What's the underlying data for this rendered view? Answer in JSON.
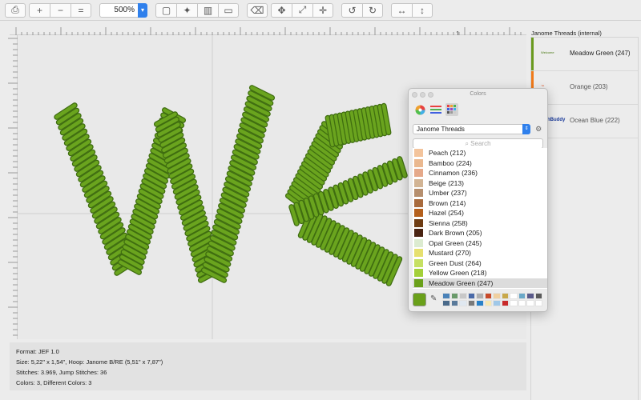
{
  "toolbar": {
    "buttons": [
      {
        "name": "print-icon",
        "glyph": "🖶"
      },
      {
        "name": "zoom-in-icon",
        "glyph": "+"
      },
      {
        "name": "zoom-out-icon",
        "glyph": "−"
      },
      {
        "name": "zoom-actual-icon",
        "glyph": "="
      },
      {
        "name": "select-rect-icon",
        "glyph": "▢"
      },
      {
        "name": "magic-wand-icon",
        "glyph": "⚚"
      },
      {
        "name": "stitch-icon",
        "glyph": "▥"
      },
      {
        "name": "ruler-icon",
        "glyph": "▭"
      },
      {
        "name": "trash-icon",
        "glyph": "🗑"
      },
      {
        "name": "move-icon",
        "glyph": "✥"
      },
      {
        "name": "resize-icon",
        "glyph": "⤢"
      },
      {
        "name": "center-icon",
        "glyph": "✛"
      },
      {
        "name": "rotate-left-icon",
        "glyph": "↺"
      },
      {
        "name": "rotate-right-icon",
        "glyph": "↻"
      },
      {
        "name": "flip-horizontal-icon",
        "glyph": "↔"
      },
      {
        "name": "flip-vertical-icon",
        "glyph": "↕"
      }
    ],
    "zoom_value": "500%"
  },
  "ruler": {
    "marker": "1"
  },
  "info": {
    "format": "Format: JEF 1.0",
    "size": "Size: 5,22\" x 1,54\", Hoop: Janome B/RE (5,51\" x 7,87\")",
    "stitches": "Stitches: 3.969, Jump Stitches: 36",
    "colors": "Colors: 3, Different Colors: 3"
  },
  "right_panel": {
    "title": "Janome Threads (internal)",
    "items": [
      {
        "label": "Meadow Green (247)",
        "bar_color": "#6a9a1f",
        "thumb_text": "Welcome",
        "thumb_color": "#4a7a14"
      },
      {
        "label": "Orange (203)",
        "bar_color": "#f07a1a",
        "thumb_text": "™",
        "thumb_color": "#e04a1a"
      },
      {
        "label": "Ocean Blue (222)",
        "bar_color": "#ececec",
        "thumb_text": "hBuddy",
        "thumb_color": "#1a3a9a"
      }
    ]
  },
  "colors_window": {
    "title": "Colors",
    "catalog": "Janome Threads",
    "search_placeholder": "Search",
    "current_color": "#6aa01a",
    "threads": [
      {
        "label": "Peach (212)",
        "color": "#f3c49c"
      },
      {
        "label": "Bamboo (224)",
        "color": "#eab88f"
      },
      {
        "label": "Cinnamon (236)",
        "color": "#e5a98a"
      },
      {
        "label": "Beige (213)",
        "color": "#d2b494"
      },
      {
        "label": "Umber (237)",
        "color": "#b68f6e"
      },
      {
        "label": "Brown (214)",
        "color": "#a86a3c"
      },
      {
        "label": "Hazel (254)",
        "color": "#b4601c"
      },
      {
        "label": "Sienna (258)",
        "color": "#6e3c12"
      },
      {
        "label": "Dark Brown (205)",
        "color": "#4a2412"
      },
      {
        "label": "Opal Green (245)",
        "color": "#dcebd0"
      },
      {
        "label": "Mustard (270)",
        "color": "#e6e070"
      },
      {
        "label": "Green Dust (264)",
        "color": "#c6e062"
      },
      {
        "label": "Yellow Green (218)",
        "color": "#a4d03a"
      },
      {
        "label": "Meadow Green (247)",
        "color": "#6aa01a",
        "selected": true
      }
    ],
    "swatches": [
      "#4a82b8",
      "#6a9a6a",
      "#c8c8c8",
      "#4a6aa8",
      "#b0b0b0",
      "#c84a2a",
      "#f0d0a0",
      "#c8a84a",
      "#ffffff",
      "#6aa8c8",
      "#5a5a8a",
      "#5a5a5a",
      "#4a6a8a",
      "#5a7a9a",
      "#e0e8f0",
      "#7a7a7a",
      "#2a82c8",
      "#f8e8b0",
      "#a0c8e8",
      "#c82a2a",
      "#ffffff",
      "#ffffff",
      "#ffffff",
      "#ffffff"
    ]
  }
}
